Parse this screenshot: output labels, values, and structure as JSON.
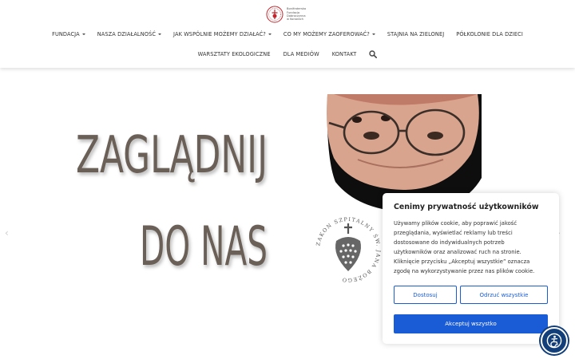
{
  "logo": {
    "text_lines": [
      "Bonifraterska",
      "Fundacja",
      "Dobroczynna",
      "w Konarach"
    ]
  },
  "nav": {
    "row1": [
      {
        "label": "FUNDACJA",
        "dropdown": true
      },
      {
        "label": "NASZA DZIAŁALNOŚĆ",
        "dropdown": true
      },
      {
        "label": "JAK WSPÓLNIE MOŻEMY DZIAŁAĆ?",
        "dropdown": true
      },
      {
        "label": "CO MY MOŻEMY ZAOFEROWAĆ?",
        "dropdown": true
      },
      {
        "label": "STAJNIA NA ZIELONEJ",
        "dropdown": false
      },
      {
        "label": "PÓŁKOLONIE DLA DZIECI",
        "dropdown": false
      }
    ],
    "row2": [
      {
        "label": "WARSZTATY EKOLOGICZNE",
        "dropdown": false
      },
      {
        "label": "DLA MEDIÓW",
        "dropdown": false
      },
      {
        "label": "KONTAKT",
        "dropdown": false
      }
    ],
    "search_icon": "search-icon"
  },
  "hero": {
    "line1": "ZAGLĄDNIJ",
    "line2": "DO NAS",
    "seal_text": "ZAKON SZPITALNY ŚW. JANA BOŻEGO",
    "prev_arrow": "‹",
    "next_arrow": "›"
  },
  "cookie": {
    "title": "Cenimy prywatność użytkowników",
    "text_lines": [
      "Używamy plików cookie, aby poprawić jakość",
      "przeglądania, wyświetlać reklamy lub treści",
      "dostosowane do indywidualnych potrzeb",
      "użytkowników oraz analizować ruch na stronie.",
      "Kliknięcie przycisku „Akceptuj wszystkie” oznacza",
      "zgodę na wykorzystywanie przez nas plików cookie."
    ],
    "customize_label": "Dostosuj",
    "reject_label": "Odrzuć wszystkie",
    "accept_label": "Akceptuj wszystko"
  },
  "accessibility": {
    "icon": "accessibility-icon"
  },
  "colors": {
    "accent_blue": "#1a5bd6",
    "access_navy": "#123f7a",
    "logo_red": "#c0262d",
    "hero_text": "#6b6158"
  }
}
